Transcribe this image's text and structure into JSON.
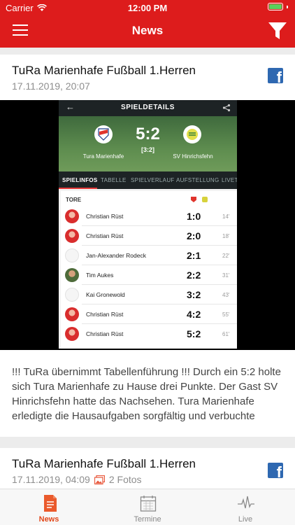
{
  "status_bar": {
    "carrier": "Carrier",
    "time": "12:00 PM",
    "battery_level": 1.0
  },
  "nav": {
    "title": "News",
    "menu_icon": "hamburger-menu-icon",
    "filter_icon": "funnel-filter-icon"
  },
  "colors": {
    "brand_red": "#dd1c1c",
    "active_tab": "#e2481b",
    "facebook_blue": "#2e68b1"
  },
  "feed": [
    {
      "title": "TuRa Marienhafe Fußball 1.Herren",
      "date": "17.11.2019, 20:07",
      "share_icon": "facebook-icon",
      "excerpt": "!!! TuRa übernimmt Tabellenführung !!! Durch ein 5:2 holte sich Tura Marienhafe zu Hause drei Punkte. Der Gast SV Hinrichsfehn hatte das Nachsehen. Tura Marienhafe erledigte die Hausaufgaben sorgfältig und verbuchte gegen den Underdog einen Dreier. Ein Doppelpack brach…",
      "screenshot": {
        "header_title": "SPIELDETAILS",
        "home_team": "Tura Marienhafe",
        "away_team": "SV Hinrichsfehn",
        "score": "5:2",
        "halftime": "[3:2]",
        "tabs": [
          "SPIELINFOS",
          "TABELLE",
          "SPIELVERLAUF",
          "AUFSTELLUNG",
          "LIVETI"
        ],
        "goals_label": "TORE",
        "goals": [
          {
            "player": "Christian Rüst",
            "score": "1:0",
            "minute": "14'"
          },
          {
            "player": "Christian Rüst",
            "score": "2:0",
            "minute": "18'"
          },
          {
            "player": "Jan-Alexander Rodeck",
            "score": "2:1",
            "minute": "22'"
          },
          {
            "player": "Tim Aukes",
            "score": "2:2",
            "minute": "31'"
          },
          {
            "player": "Kai Gronewold",
            "score": "3:2",
            "minute": "43'"
          },
          {
            "player": "Christian Rüst",
            "score": "4:2",
            "minute": "55'"
          },
          {
            "player": "Christian Rüst",
            "score": "5:2",
            "minute": "61'"
          }
        ]
      }
    },
    {
      "title": "TuRa Marienhafe Fußball 1.Herren",
      "date": "17.11.2019, 04:09",
      "photos": "2 Fotos",
      "share_icon": "facebook-icon"
    }
  ],
  "tabbar": {
    "news": "News",
    "termine": "Termine",
    "live": "Live"
  }
}
